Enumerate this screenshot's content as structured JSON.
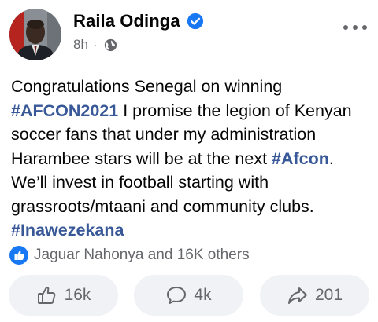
{
  "post": {
    "author": "Raila Odinga",
    "time": "8h",
    "separator": "·",
    "text_parts": {
      "p1": "Congratulations Senegal on winning ",
      "tag1": "#AFCON2021",
      "p2": " I promise the legion of Kenyan soccer fans that under my administration Harambee stars will be at the next ",
      "tag2": "#Afcon",
      "p3": ". We’ll invest in football starting with grassroots/mtaani and community clubs. ",
      "tag3": "#Inawezekana"
    },
    "reactions_summary": "Jaguar Nahonya and 16K others"
  },
  "actions": {
    "like_count": "16k",
    "comment_count": "4k",
    "share_count": "201"
  },
  "icons": {
    "verified": "verified-badge-icon",
    "audience": "globe-icon",
    "more": "more-options-icon",
    "like_badge": "like-reaction-icon",
    "like": "thumbs-up-icon",
    "comment": "comment-bubble-icon",
    "share": "share-arrow-icon"
  },
  "colors": {
    "accent": "#1877f2",
    "hashtag": "#385898",
    "secondary_text": "#65676b",
    "button_bg": "#f0f2f5"
  }
}
